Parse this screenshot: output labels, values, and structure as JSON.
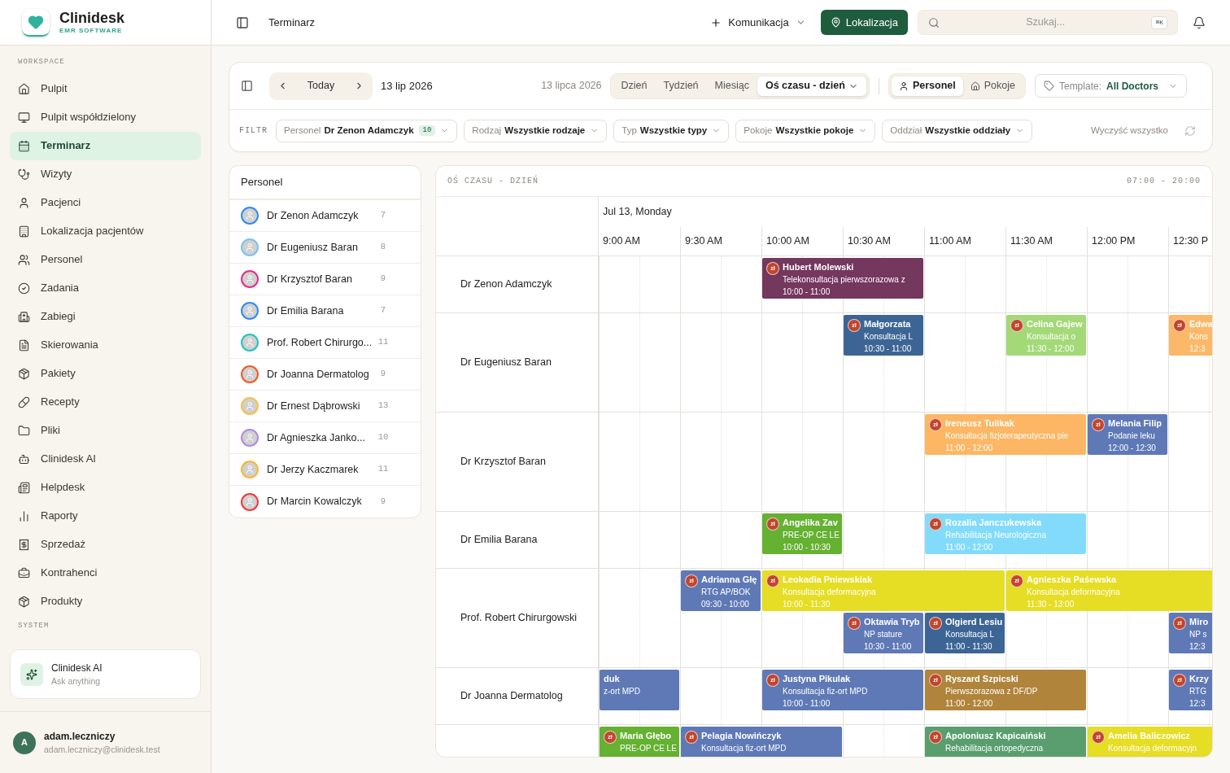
{
  "brand": {
    "name": "Clinidesk",
    "tagline": "EMR SOFTWARE"
  },
  "sidebar": {
    "sections": [
      {
        "title": "WORKSPACE",
        "items": [
          {
            "label": "Pulpit",
            "selected": false
          },
          {
            "label": "Pulpit współdzielony",
            "selected": false
          },
          {
            "label": "Terminarz",
            "selected": true
          },
          {
            "label": "Wizyty",
            "selected": false
          },
          {
            "label": "Pacjenci",
            "selected": false
          },
          {
            "label": "Lokalizacja pacjentów",
            "selected": false
          },
          {
            "label": "Personel",
            "selected": false
          },
          {
            "label": "Zadania",
            "selected": false
          },
          {
            "label": "Zabiegi",
            "selected": false
          },
          {
            "label": "Skierowania",
            "selected": false
          },
          {
            "label": "Pakiety",
            "selected": false
          },
          {
            "label": "Recepty",
            "selected": false
          },
          {
            "label": "Pliki",
            "selected": false
          },
          {
            "label": "Clinidesk AI",
            "selected": false
          },
          {
            "label": "Helpdesk",
            "selected": false
          },
          {
            "label": "Raporty",
            "selected": false
          },
          {
            "label": "Sprzedaż",
            "selected": false
          },
          {
            "label": "Kontrahenci",
            "selected": false
          },
          {
            "label": "Produkty",
            "selected": false
          }
        ]
      },
      {
        "title": "SYSTEM"
      }
    ],
    "ai_card": {
      "title": "Clinidesk AI",
      "subtitle": "Ask anything"
    },
    "user": {
      "initial": "A",
      "name": "adam.leczniczy",
      "email": "adam.leczniczy@clinidesk.test"
    }
  },
  "topbar": {
    "title": "Terminarz",
    "communication": "Komunikacja",
    "location": "Lokalizacja",
    "search": {
      "placeholder": "Szukaj..."
    },
    "shortcut": "⌘K"
  },
  "toolbar": {
    "today": "Today",
    "date": "13 lip 2026",
    "long_date": "13 lipca 2026",
    "views": [
      {
        "label": "Dzień",
        "selected": false
      },
      {
        "label": "Tydzień",
        "selected": false
      },
      {
        "label": "Miesiąc",
        "selected": false
      },
      {
        "label": "Oś czasu - dzień",
        "selected": true
      }
    ],
    "resources": [
      {
        "label": "Personel",
        "selected": true
      },
      {
        "label": "Pokoje",
        "selected": false
      }
    ],
    "template": {
      "label": "Template:",
      "value": "All Doctors"
    }
  },
  "filters": {
    "label": "FILTR",
    "items": [
      {
        "label": "Personel",
        "value": "Dr Zenon Adamczyk",
        "count": "10"
      },
      {
        "label": "Rodzaj",
        "value": "Wszystkie rodzaje"
      },
      {
        "label": "Typ",
        "value": "Wszystkie typy"
      },
      {
        "label": "Pokoje",
        "value": "Wszystkie pokoje"
      },
      {
        "label": "Oddział",
        "value": "Wszystkie oddziały"
      }
    ],
    "clear": "Wyczyść wszystko"
  },
  "staff": {
    "title": "Personel",
    "items": [
      {
        "name": "Dr Zenon Adamczyk",
        "count": "7",
        "color": "#2f8cf0"
      },
      {
        "name": "Dr Eugeniusz Baran",
        "count": "8",
        "color": "#7cc0f4"
      },
      {
        "name": "Dr Krzysztof Baran",
        "count": "9",
        "color": "#e0308a"
      },
      {
        "name": "Dr Emilia Barana",
        "count": "7",
        "color": "#2f8cf0"
      },
      {
        "name": "Prof. Robert Chirurgo...",
        "count": "11",
        "color": "#22c3bf"
      },
      {
        "name": "Dr Joanna Dermatolog",
        "count": "9",
        "color": "#f25a2a"
      },
      {
        "name": "Dr Ernest Dąbrowski",
        "count": "13",
        "color": "#f7c04a"
      },
      {
        "name": "Dr Agnieszka Janko...",
        "count": "10",
        "color": "#b08ae6"
      },
      {
        "name": "Dr Jerzy Kaczmarek",
        "count": "11",
        "color": "#f7b733"
      },
      {
        "name": "Dr Marcin Kowalczyk",
        "count": "9",
        "color": "#ee3b3b"
      }
    ]
  },
  "timeline": {
    "title": "OŚ CZASU - DZIEŃ",
    "range": "07:00 - 20:00",
    "date": "Jul 13, Monday",
    "times": [
      "9:00 AM",
      "9:30 AM",
      "10:00 AM",
      "10:30 AM",
      "11:00 AM",
      "11:30 AM",
      "12:00 PM",
      "12:30 P"
    ],
    "rows": [
      {
        "name": "Dr Zenon Adamczyk",
        "events": [
          {
            "badge": "zł",
            "name": "Hubert Molewski",
            "detail": "Telekonsultacja pierwszorazowa z",
            "time": "10:00 - 11:00",
            "color": "#74375e"
          }
        ]
      },
      {
        "name": "Dr Eugeniusz Baran",
        "events": [
          {
            "badge": "zł",
            "name": "Małgorzata",
            "detail": "Konsultacja L",
            "time": "10:30 - 11:00",
            "color": "#3c6595"
          },
          {
            "badge": "zł",
            "name": "Celina Gajew",
            "detail": "Konsultacja o",
            "time": "11:30 - 12:00",
            "color": "#a3d977"
          },
          {
            "badge": "zł",
            "name": "Edwa",
            "detail": "Kons",
            "time": "12:3",
            "color": "#fbb868"
          }
        ]
      },
      {
        "name": "Dr Krzysztof Baran",
        "events": [
          {
            "badge": "zł",
            "name": "Ireneusz Tulikak",
            "detail": "Konsultacja fizjoterapeutyczna pie",
            "time": "11:00 - 12:00",
            "color": "#fdb663"
          },
          {
            "badge": "zł",
            "name": "Melania Filip",
            "detail": "Podanie leku",
            "time": "12:00 - 12:30",
            "color": "#5f79b7"
          }
        ]
      },
      {
        "name": "Dr Emilia Barana",
        "events": [
          {
            "badge": "zł",
            "name": "Angelika Zav",
            "detail": "PRE-OP CE LE",
            "time": "10:00 - 10:30",
            "color": "#65b132"
          },
          {
            "badge": "zł",
            "name": "Rozalia Janczukewska",
            "detail": "Rehabilitacja Neurologiczna",
            "time": "11:00 - 12:00",
            "color": "#82dbfb"
          }
        ]
      },
      {
        "name": "Prof. Robert Chirurgowski",
        "events": [
          {
            "badge": "zł",
            "name": "Adrianna Głę",
            "detail": "RTG AP/BOK",
            "time": "09:30 - 10:00",
            "color": "#5f79b7"
          },
          {
            "badge": "zł",
            "name": "Leokadia Pniewskiak",
            "detail": "Konsultacja deformacyjna",
            "time": "10:00 - 11:30",
            "color": "#e6dd25"
          },
          {
            "badge": "zł",
            "name": "Agnieszka Paśewska",
            "detail": "Konsultacja deformacyjna",
            "time": "11:30 - 13:00",
            "color": "#e6dd25"
          },
          {
            "badge": "zł",
            "name": "Oktawia Tryb",
            "detail": "NP stature",
            "time": "10:30 - 11:00",
            "color": "#5f79b7"
          },
          {
            "badge": "zł",
            "name": "Olgierd Lesiu",
            "detail": "Konsultacja L",
            "time": "11:00 - 11:30",
            "color": "#3c6595"
          },
          {
            "badge": "zł",
            "name": "Miro",
            "detail": "NP s",
            "time": "12:3",
            "color": "#5f79b7"
          }
        ]
      },
      {
        "name": "Dr Joanna Dermatolog",
        "events": [
          {
            "name": "duk",
            "detail": "z-ort MPD",
            "color": "#5f79b7"
          },
          {
            "badge": "zł",
            "name": "Justyna Pikulak",
            "detail": "Konsultacja fiz-ort MPD",
            "time": "10:00 - 11:00",
            "color": "#5f79b7"
          },
          {
            "badge": "zł",
            "name": "Ryszard Szpicski",
            "detail": "Pierwszorazowa z DF/DP",
            "time": "11:00 - 12:00",
            "color": "#b0843a"
          },
          {
            "badge": "zł",
            "name": "Krzy",
            "detail": "RTG",
            "time": "12:3",
            "color": "#5f79b7"
          }
        ]
      },
      {
        "events": [
          {
            "badge": "zł",
            "name": "Maria Głębo",
            "detail": "PRE-OP CE LE",
            "color": "#65b132"
          },
          {
            "badge": "zł",
            "name": "Pelagia Nowińczyk",
            "detail": "Konsultacja fiz-ort MPD",
            "color": "#5f79b7"
          },
          {
            "badge": "zł",
            "name": "Apoloniusz Kapicaiński",
            "detail": "Rehabilitacja ortopedyczna",
            "color": "#5a9e6f"
          },
          {
            "badge": "zł",
            "name": "Amelia Baliczowicz",
            "detail": "Konsultacja deformacyjn",
            "color": "#e6dd25"
          }
        ]
      }
    ]
  }
}
